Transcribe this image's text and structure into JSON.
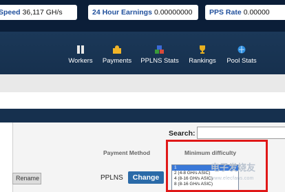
{
  "stats": {
    "speed": {
      "label": "Speed",
      "value": "36,117 GH/s"
    },
    "earnings": {
      "label": "24 Hour Earnings",
      "value": "0.00000000"
    },
    "pps": {
      "label": "PPS Rate",
      "value": "0.00000"
    }
  },
  "nav": {
    "workers": {
      "label": "Workers",
      "icon": "workers-icon"
    },
    "payments": {
      "label": "Payments",
      "icon": "payments-icon"
    },
    "pplns": {
      "label": "PPLNS Stats",
      "icon": "pplns-stats-icon"
    },
    "rankings": {
      "label": "Rankings",
      "icon": "trophy-icon"
    },
    "pool": {
      "label": "Pool Stats",
      "icon": "pool-stats-icon"
    }
  },
  "search": {
    "label": "Search:"
  },
  "table": {
    "headers": {
      "payment_method": "Payment Method",
      "min_difficulty": "Minimum difficulty"
    },
    "row": {
      "rename_label": "Rename",
      "method": "PPLNS",
      "change_label": "Change"
    }
  },
  "difficulty_options": [
    {
      "label": "1",
      "selected": true
    },
    {
      "label": "2 (4-8 GH/s ASIC)",
      "selected": false
    },
    {
      "label": "4 (8-16 GH/s ASIC)",
      "selected": false
    },
    {
      "label": "8 (8-16 GH/s ASIC)",
      "selected": false
    }
  ],
  "watermark": {
    "line1": "电子发烧友",
    "line2": "www.elecfans.com"
  },
  "colors": {
    "topbar": "#0b1e38",
    "navbar": "#16304e",
    "highlight": "#e01818",
    "button": "#2a6aa8"
  }
}
